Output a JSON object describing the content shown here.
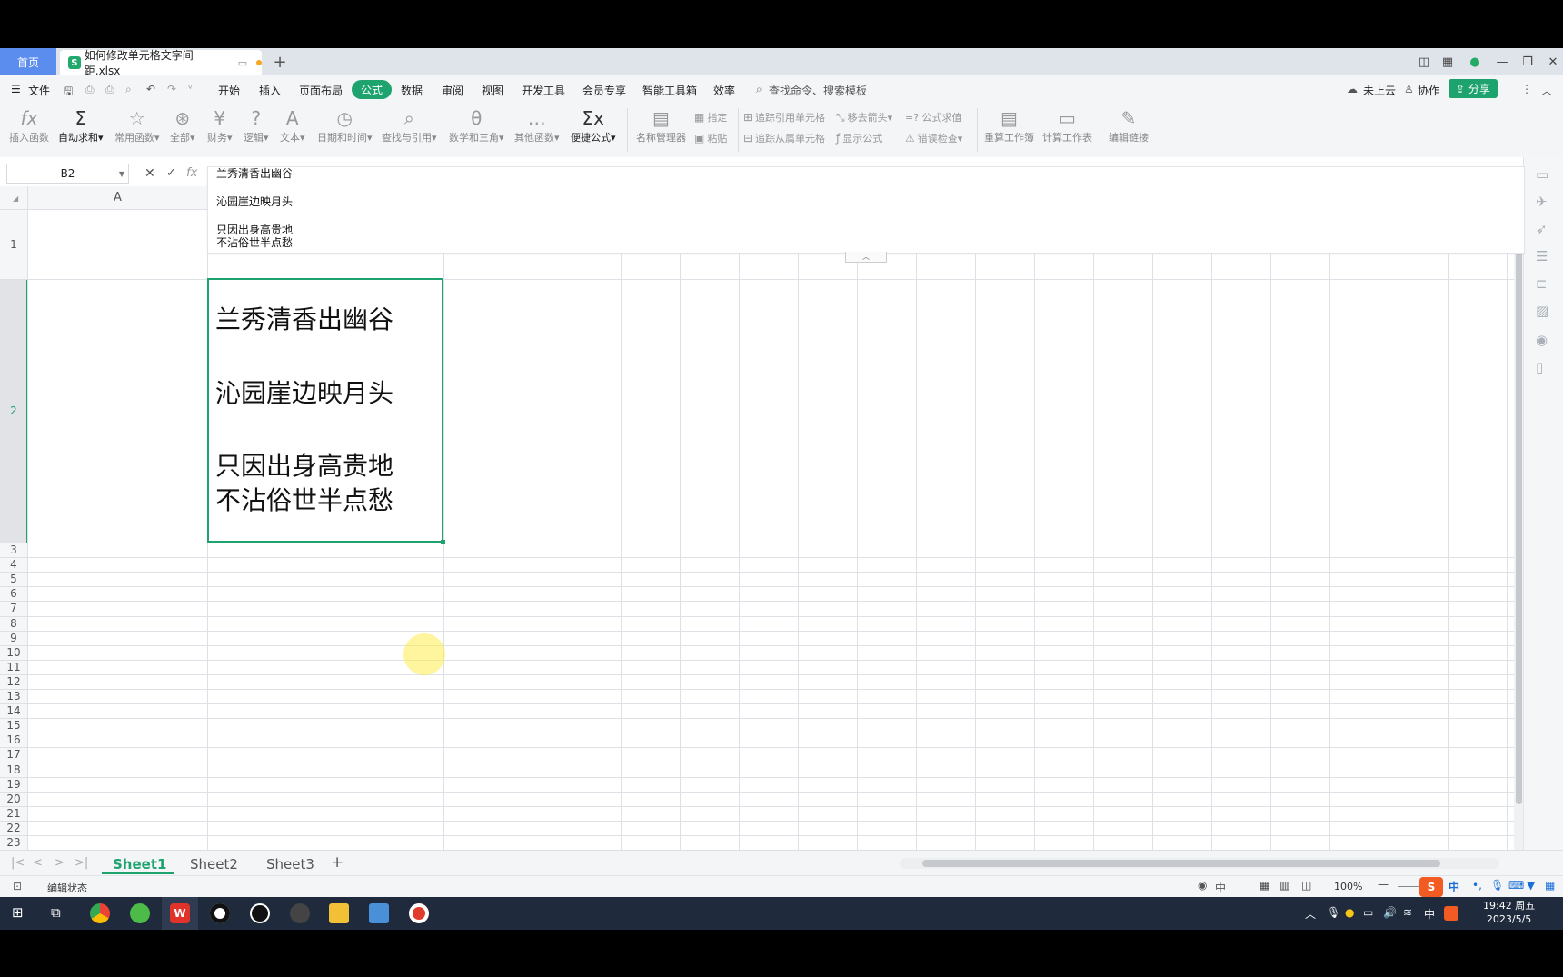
{
  "titlebar": {
    "home_tab": "首页",
    "doc_tab_icon": "S",
    "doc_tab_title": "如何修改单元格文字间距.xlsx",
    "new_tab": "+"
  },
  "menubar": {
    "file": "文件",
    "items": [
      "开始",
      "插入",
      "页面布局",
      "公式",
      "数据",
      "审阅",
      "视图",
      "开发工具",
      "会员专享",
      "智能工具箱",
      "效率"
    ],
    "search_placeholder": "查找命令、搜索模板",
    "cloud": "未上云",
    "collab": "协作",
    "share": "分享"
  },
  "ribbon": {
    "buttons": [
      "插入函数",
      "自动求和▾",
      "常用函数▾",
      "全部▾",
      "财务▾",
      "逻辑▾",
      "文本▾",
      "日期和时间▾",
      "查找与引用▾",
      "数学和三角▾",
      "其他函数▾",
      "便捷公式▾",
      "名称管理器"
    ],
    "small": [
      "指定",
      "粘贴",
      "追踪引用单元格",
      "追踪从属单元格",
      "移去箭头▾",
      "显示公式",
      "=? 公式求值",
      "错误检查▾"
    ],
    "calc": [
      "重算工作簿",
      "计算工作表"
    ],
    "edit_links": "编辑链接"
  },
  "formula_bar": {
    "name_box": "B2",
    "fx": "fx",
    "content_lines": [
      "兰秀清香出幽谷",
      "沁园崖边映月头",
      "只因出身高贵地",
      "不沾俗世半点愁"
    ]
  },
  "grid": {
    "col_header_a": "A",
    "row_labels": [
      "1",
      "2",
      "3",
      "4",
      "5",
      "6",
      "7",
      "8",
      "9",
      "10",
      "11",
      "12",
      "13",
      "14",
      "15",
      "16",
      "17",
      "18",
      "19",
      "20",
      "21",
      "22",
      "23"
    ],
    "cell_b2_lines": [
      "兰秀清香出幽谷",
      "沁园崖边映月头",
      "只因出身高贵地",
      "不沾俗世半点愁"
    ]
  },
  "sheets": [
    "Sheet1",
    "Sheet2",
    "Sheet3"
  ],
  "add_sheet": "+",
  "status": {
    "mode": "编辑状态",
    "zoom": "100%",
    "lang": "中"
  },
  "taskbar": {
    "time": "19:42 周五",
    "date": "2023/5/5",
    "ime": "中"
  },
  "colors": {
    "accent": "#1ea36e",
    "home_tab": "#5b8def",
    "taskbar": "#1f2a3c"
  }
}
